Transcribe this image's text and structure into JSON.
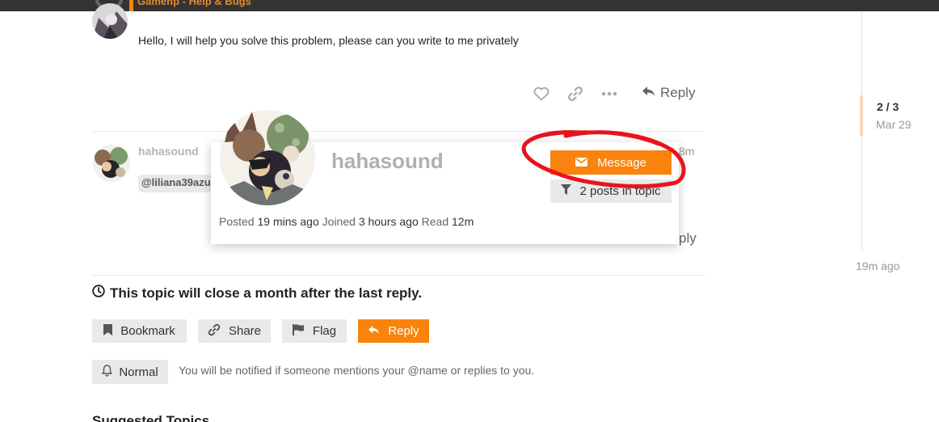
{
  "header": {
    "breadcrumb": "Gamehp - Help & Bugs"
  },
  "post1": {
    "text": "Hello, I will help you solve this problem, please can you write to me privately",
    "actions": {
      "like_icon": "heart-icon",
      "link_icon": "link-icon",
      "more_icon": "ellipsis-icon",
      "reply_label": "Reply"
    }
  },
  "post2": {
    "username": "hahasound",
    "mention": "@liliana39azu",
    "age": "8m",
    "reply_fragment": "ply"
  },
  "user_card": {
    "username": "hahasound",
    "message_label": "Message",
    "posts_label": "2 posts in topic",
    "meta": {
      "posted_label": "Posted",
      "posted_value": "19 mins ago",
      "joined_label": "Joined",
      "joined_value": "3 hours ago",
      "read_label": "Read",
      "read_value": "12m"
    }
  },
  "timeline": {
    "position": "2 / 3",
    "date": "Mar 29",
    "ago": "19m ago"
  },
  "topic_footer": {
    "close_notice": "This topic will close a month after the last reply.",
    "buttons": {
      "bookmark": "Bookmark",
      "share": "Share",
      "flag": "Flag",
      "reply": "Reply"
    },
    "notification_level": "Normal",
    "notification_text": "You will be notified if someone mentions your @name or replies to you."
  },
  "suggested_heading": "Suggested Topics",
  "colors": {
    "accent": "#f9830c",
    "annotation": "#e8141c",
    "header_bg": "#333333"
  }
}
